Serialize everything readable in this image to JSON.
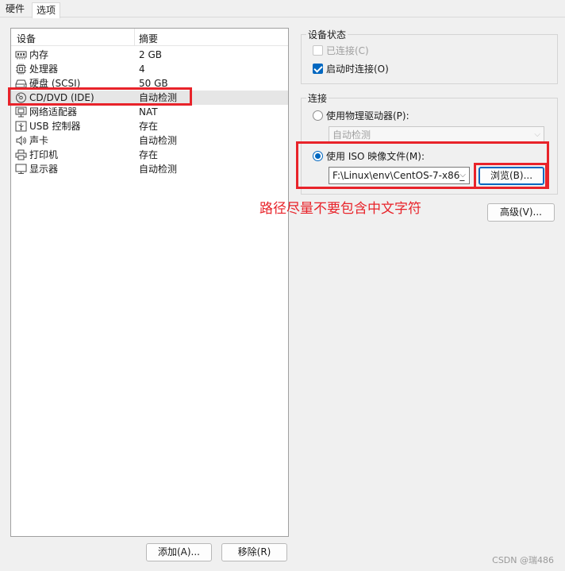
{
  "tabs": [
    {
      "label": "硬件"
    },
    {
      "label": "选项"
    }
  ],
  "device_list": {
    "headers": {
      "device": "设备",
      "summary": "摘要"
    },
    "rows": [
      {
        "name": "内存",
        "summary": "2 GB",
        "icon": "memory-icon"
      },
      {
        "name": "处理器",
        "summary": "4",
        "icon": "cpu-icon"
      },
      {
        "name": "硬盘 (SCSI)",
        "summary": "50 GB",
        "icon": "harddisk-icon"
      },
      {
        "name": "CD/DVD (IDE)",
        "summary": "自动检测",
        "icon": "cd-icon"
      },
      {
        "name": "网络适配器",
        "summary": "NAT",
        "icon": "network-icon"
      },
      {
        "name": "USB 控制器",
        "summary": "存在",
        "icon": "usb-icon"
      },
      {
        "name": "声卡",
        "summary": "自动检测",
        "icon": "speaker-icon"
      },
      {
        "name": "打印机",
        "summary": "存在",
        "icon": "printer-icon"
      },
      {
        "name": "显示器",
        "summary": "自动检测",
        "icon": "monitor-icon"
      }
    ],
    "selected_index": 3
  },
  "device_status": {
    "title": "设备状态",
    "connected_label": "已连接(C)",
    "connected": false,
    "connect_on_power_label": "启动时连接(O)",
    "connect_on_power": true
  },
  "connection": {
    "title": "连接",
    "physical_drive_label": "使用物理驱动器(P):",
    "physical_drive_value": "自动检测",
    "iso_label": "使用 ISO 映像文件(M):",
    "iso_path": "F:\\Linux\\env\\CentOS-7-x86_",
    "browse_label": "浏览(B)...",
    "selected": "iso"
  },
  "advanced_label": "高级(V)...",
  "add_label": "添加(A)...",
  "remove_label": "移除(R)",
  "annotation_text": "路径尽量不要包含中文字符",
  "watermark": "CSDN @瑞486",
  "colors": {
    "accent": "#0067c0",
    "highlight_red": "#e8232a"
  }
}
